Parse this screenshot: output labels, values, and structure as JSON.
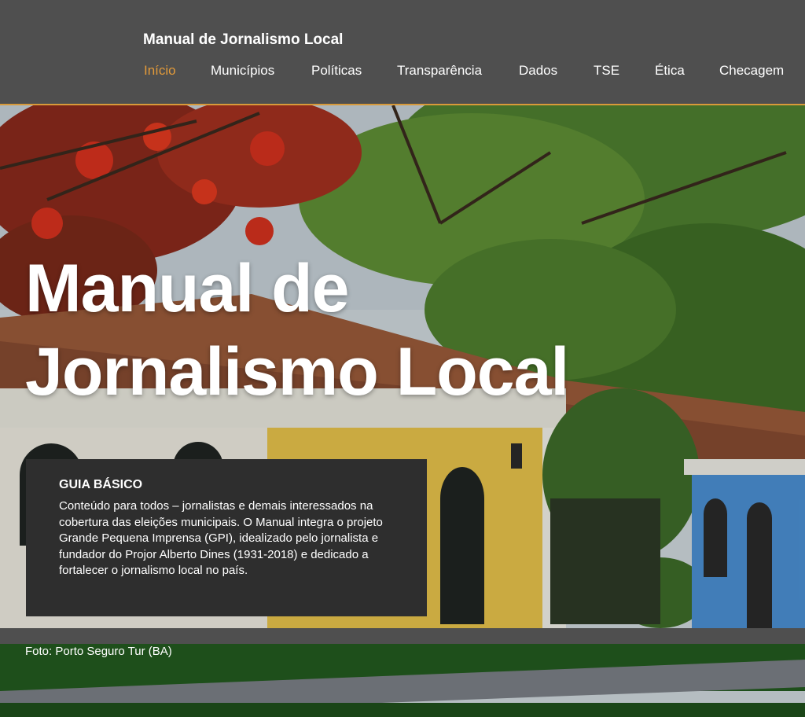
{
  "header": {
    "site_title": "Manual de Jornalismo Local",
    "nav": [
      {
        "label": "Início",
        "active": true
      },
      {
        "label": "Municípios",
        "active": false
      },
      {
        "label": "Políticas",
        "active": false
      },
      {
        "label": "Transparência",
        "active": false
      },
      {
        "label": "Dados",
        "active": false
      },
      {
        "label": "TSE",
        "active": false
      },
      {
        "label": "Ética",
        "active": false
      },
      {
        "label": "Checagem",
        "active": false
      }
    ]
  },
  "hero": {
    "title_line1": "Manual de",
    "title_line2": "Jornalismo Local",
    "info_heading": "GUIA BÁSICO",
    "info_text": "Conteúdo para todos – jornalistas e demais interessados na cobertura das eleições municipais. O Manual  integra o projeto Grande Pequena Imprensa (GPI), idealizado pelo jornalista e fundador do Projor Alberto Dines (1931-2018) e dedicado a fortalecer o jornalismo local no país.",
    "photo_credit": "Foto: Porto Seguro Tur (BA)"
  },
  "colors": {
    "header_bg": "#4f4f4f",
    "accent": "#e29a3a",
    "box_bg": "#2e2e2e"
  }
}
